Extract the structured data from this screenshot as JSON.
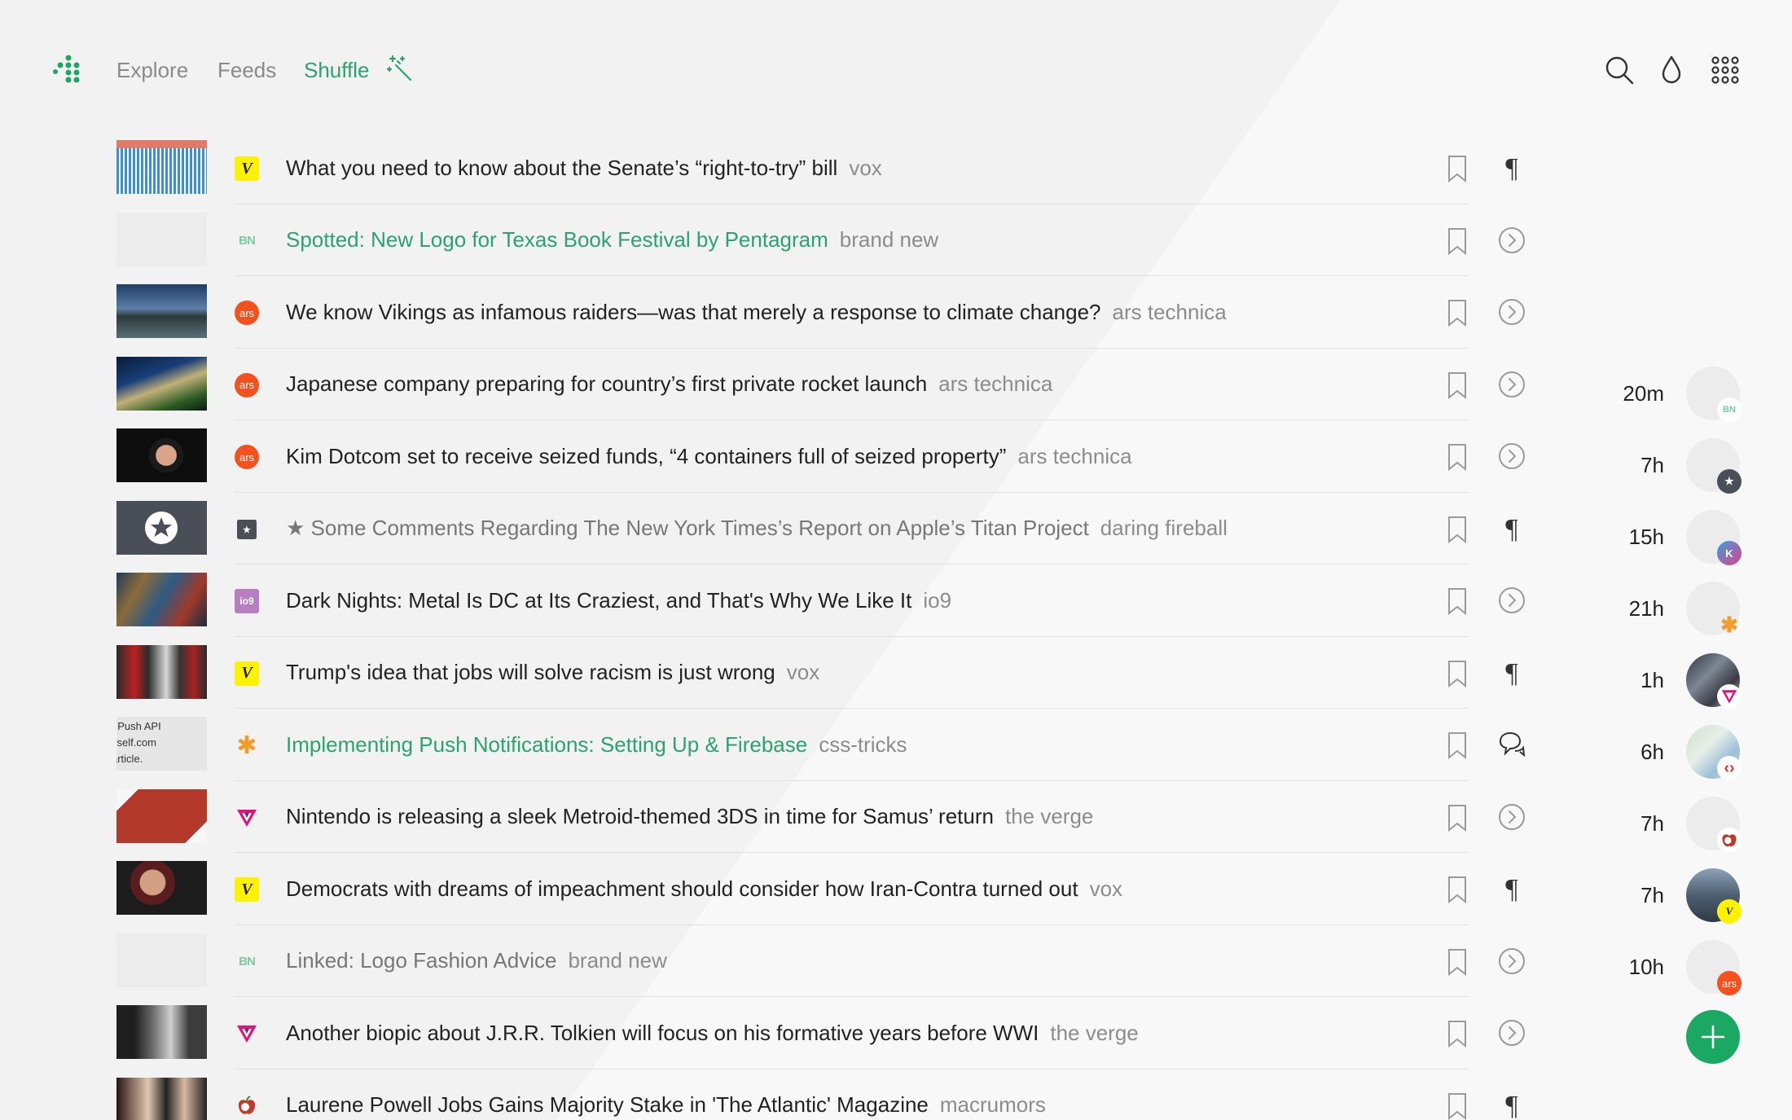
{
  "nav": {
    "explore": "Explore",
    "feeds": "Feeds",
    "shuffle": "Shuffle"
  },
  "colors": {
    "accent": "#2ba271",
    "fab": "#1aa863",
    "ars": "#f4511e",
    "vox": "#fff200"
  },
  "articles": [
    {
      "icon": "vox-icon",
      "icon_text": "V",
      "title": "What you need to know about the Senate’s “right-to-try” bill",
      "source": "vox",
      "state": "unread",
      "action": "pilcrow-icon"
    },
    {
      "icon": "brand-new-icon",
      "icon_text": "BN",
      "title": "Spotted: New Logo for Texas Book Festival by Pentagram",
      "source": "brand new",
      "state": "link",
      "action": "arrow-circle-icon"
    },
    {
      "icon": "ars-icon",
      "icon_text": "ars",
      "title": "We know Vikings as infamous raiders—was that merely a response to climate change?",
      "source": "ars technica",
      "state": "unread",
      "action": "arrow-circle-icon"
    },
    {
      "icon": "ars-icon",
      "icon_text": "ars",
      "title": "Japanese company preparing for country’s first private rocket launch",
      "source": "ars technica",
      "state": "unread",
      "action": "arrow-circle-icon"
    },
    {
      "icon": "ars-icon",
      "icon_text": "ars",
      "title": "Kim Dotcom set to receive seized funds, “4 containers full of seized property”",
      "source": "ars technica",
      "state": "unread",
      "action": "arrow-circle-icon"
    },
    {
      "icon": "daring-fireball-icon",
      "icon_text": "★",
      "title": "★ Some Comments Regarding The New York Times’s Report on Apple’s Titan Project",
      "source": "daring fireball",
      "state": "read",
      "action": "pilcrow-icon"
    },
    {
      "icon": "io9-icon",
      "icon_text": "io9",
      "title": "Dark Nights: Metal Is DC at Its Craziest, and That's Why We Like It",
      "source": "io9",
      "state": "unread",
      "action": "arrow-circle-icon"
    },
    {
      "icon": "vox-icon",
      "icon_text": "V",
      "title": "Trump's idea that jobs will solve racism is just wrong",
      "source": "vox",
      "state": "unread",
      "action": "pilcrow-icon"
    },
    {
      "icon": "css-tricks-icon",
      "icon_text": "✱",
      "title": "Implementing Push Notifications: Setting Up & Firebase",
      "source": "css-tricks",
      "state": "link",
      "action": "comments-icon",
      "thumb_text": ": Push API\nyself.com\narticle."
    },
    {
      "icon": "verge-icon",
      "icon_text": "V",
      "title": "Nintendo is releasing a sleek Metroid-themed 3DS in time for Samus’ return",
      "source": "the verge",
      "state": "unread",
      "action": "arrow-circle-icon"
    },
    {
      "icon": "vox-icon",
      "icon_text": "V",
      "title": "Democrats with dreams of impeachment should consider how Iran-Contra turned out",
      "source": "vox",
      "state": "unread",
      "action": "pilcrow-icon"
    },
    {
      "icon": "brand-new-icon",
      "icon_text": "BN",
      "title": "Linked: Logo Fashion Advice",
      "source": "brand new",
      "state": "read",
      "action": "arrow-circle-icon"
    },
    {
      "icon": "verge-icon",
      "icon_text": "V",
      "title": "Another biopic about J.R.R. Tolkien will focus on his formative years before WWI",
      "source": "the verge",
      "state": "unread",
      "action": "arrow-circle-icon"
    },
    {
      "icon": "macrumors-icon",
      "icon_text": "",
      "title": "Laurene Powell Jobs Gains Majority Stake in 'The Atlantic' Magazine",
      "source": "macrumors",
      "state": "unread",
      "action": "pilcrow-icon"
    }
  ],
  "rail": [
    {
      "time": "20m",
      "badge": "brand-new-icon",
      "badge_text": "BN"
    },
    {
      "time": "7h",
      "badge": "daring-fireball-icon",
      "badge_text": "★"
    },
    {
      "time": "15h",
      "badge": "kottke-icon",
      "badge_text": "K"
    },
    {
      "time": "21h",
      "badge": "css-tricks-icon",
      "badge_text": "✱"
    },
    {
      "time": "1h",
      "badge": "verge-icon",
      "badge_text": "V"
    },
    {
      "time": "6h",
      "badge": "code-icon",
      "badge_text": "‹›"
    },
    {
      "time": "7h",
      "badge": "macrumors-icon",
      "badge_text": ""
    },
    {
      "time": "7h",
      "badge": "vox-icon",
      "badge_text": "V"
    },
    {
      "time": "10h",
      "badge": "ars-icon",
      "badge_text": "ars"
    }
  ]
}
